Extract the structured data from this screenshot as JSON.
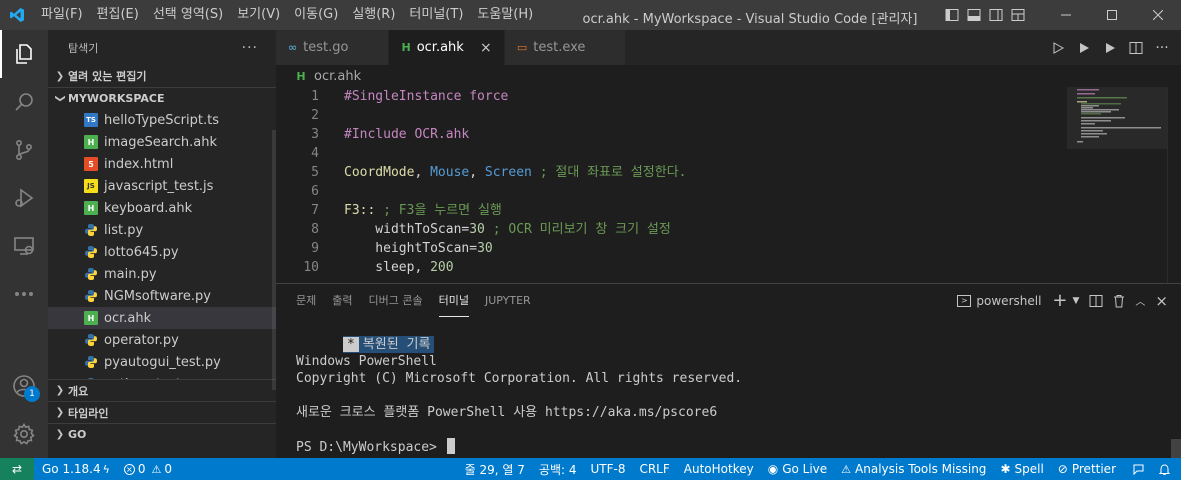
{
  "window": {
    "title": "ocr.ahk - MyWorkspace - Visual Studio Code [관리자]",
    "menu": [
      "파일(F)",
      "편집(E)",
      "선택 영역(S)",
      "보기(V)",
      "이동(G)",
      "실행(R)",
      "터미널(T)",
      "도움말(H)"
    ]
  },
  "activity_bar": {
    "items": [
      "explorer-icon",
      "search-icon",
      "source-control-icon",
      "run-debug-icon",
      "remote-explorer-icon",
      "more-icon"
    ],
    "accounts_badge": "1"
  },
  "sidebar": {
    "title": "탐색기",
    "more": "···",
    "open_editors": "열려 있는 편집기",
    "workspace": "MYWORKSPACE",
    "files": [
      {
        "name": "helloTypeScript.ts",
        "icon": "TS",
        "kind": "ts"
      },
      {
        "name": "imageSearch.ahk",
        "icon": "H",
        "kind": "h"
      },
      {
        "name": "index.html",
        "icon": "5",
        "kind": "html"
      },
      {
        "name": "javascript_test.js",
        "icon": "JS",
        "kind": "js"
      },
      {
        "name": "keyboard.ahk",
        "icon": "H",
        "kind": "h"
      },
      {
        "name": "list.py",
        "icon": "py",
        "kind": "py"
      },
      {
        "name": "lotto645.py",
        "icon": "py",
        "kind": "py"
      },
      {
        "name": "main.py",
        "icon": "py",
        "kind": "py"
      },
      {
        "name": "NGMsoftware.py",
        "icon": "py",
        "kind": "py"
      },
      {
        "name": "ocr.ahk",
        "icon": "H",
        "kind": "h"
      },
      {
        "name": "operator.py",
        "icon": "py",
        "kind": "py"
      },
      {
        "name": "pyautogui_test.py",
        "icon": "py",
        "kind": "py"
      },
      {
        "name": "python_test.py",
        "icon": "py",
        "kind": "py"
      }
    ],
    "selected_file": "ocr.ahk",
    "outline": "개요",
    "timeline": "타임라인",
    "go": "GO"
  },
  "tabs": [
    {
      "label": "test.go",
      "icon": "∞",
      "icon_color": "#519aba",
      "active": false
    },
    {
      "label": "ocr.ahk",
      "icon": "H",
      "icon_color": "#4caf50",
      "active": true,
      "close": "×"
    },
    {
      "label": "test.exe",
      "icon": "▭",
      "icon_color": "#e37933",
      "active": false
    }
  ],
  "breadcrumb": {
    "icon": "H",
    "file": "ocr.ahk"
  },
  "editor": {
    "lines": [
      {
        "n": "1",
        "parts": [
          [
            "c-dir",
            "#SingleInstance force"
          ]
        ]
      },
      {
        "n": "2",
        "parts": []
      },
      {
        "n": "3",
        "parts": [
          [
            "c-dir",
            "#Include OCR.ahk"
          ]
        ]
      },
      {
        "n": "4",
        "parts": []
      },
      {
        "n": "5",
        "parts": [
          [
            "c-fn",
            "CoordMode"
          ],
          [
            "c-txt",
            ", "
          ],
          [
            "c-kw",
            "Mouse"
          ],
          [
            "c-txt",
            ", "
          ],
          [
            "c-kw",
            "Screen"
          ],
          [
            "c-com",
            " ; 절대 좌표로 설정한다."
          ]
        ]
      },
      {
        "n": "6",
        "parts": []
      },
      {
        "n": "7",
        "parts": [
          [
            "c-lbl",
            "F3::"
          ],
          [
            "c-com",
            " ; F3을 누르면 실행"
          ]
        ]
      },
      {
        "n": "8",
        "parts": [
          [
            "c-txt",
            "    widthToScan="
          ],
          [
            "c-num",
            "30"
          ],
          [
            "c-com",
            " ; OCR 미리보기 창 크기 설정"
          ]
        ]
      },
      {
        "n": "9",
        "parts": [
          [
            "c-txt",
            "    heightToScan="
          ],
          [
            "c-num",
            "30"
          ]
        ]
      },
      {
        "n": "10",
        "parts": [
          [
            "c-txt",
            "    sleep, "
          ],
          [
            "c-num",
            "200"
          ]
        ]
      }
    ]
  },
  "panel": {
    "tabs": [
      "문제",
      "출력",
      "디버그 콘솔",
      "터미널",
      "JUPYTER"
    ],
    "active_tab": "터미널",
    "shell": "powershell",
    "terminal": {
      "restored_star": "*",
      "restored_text": "복원된 기록",
      "line1": "Windows PowerShell",
      "line2": "Copyright (C) Microsoft Corporation. All rights reserved.",
      "line3": "새로운 크로스 플랫폼 PowerShell 사용 https://aka.ms/pscore6",
      "prompt": "PS D:\\MyWorkspace> "
    }
  },
  "status_bar": {
    "remote": "⇄",
    "go_version": "Go 1.18.4",
    "errors": "0",
    "warnings": "0",
    "position": "줄 29, 열 7",
    "spaces": "공백: 4",
    "encoding": "UTF-8",
    "eol": "CRLF",
    "language": "AutoHotkey",
    "go_live": "Go Live",
    "analysis": "Analysis Tools Missing",
    "spell": "Spell",
    "prettier": "Prettier"
  },
  "colors": {
    "status_bar": "#007acc",
    "remote": "#16825d",
    "activity_bar": "#333333",
    "sidebar": "#252526",
    "editor": "#1e1e1e"
  }
}
